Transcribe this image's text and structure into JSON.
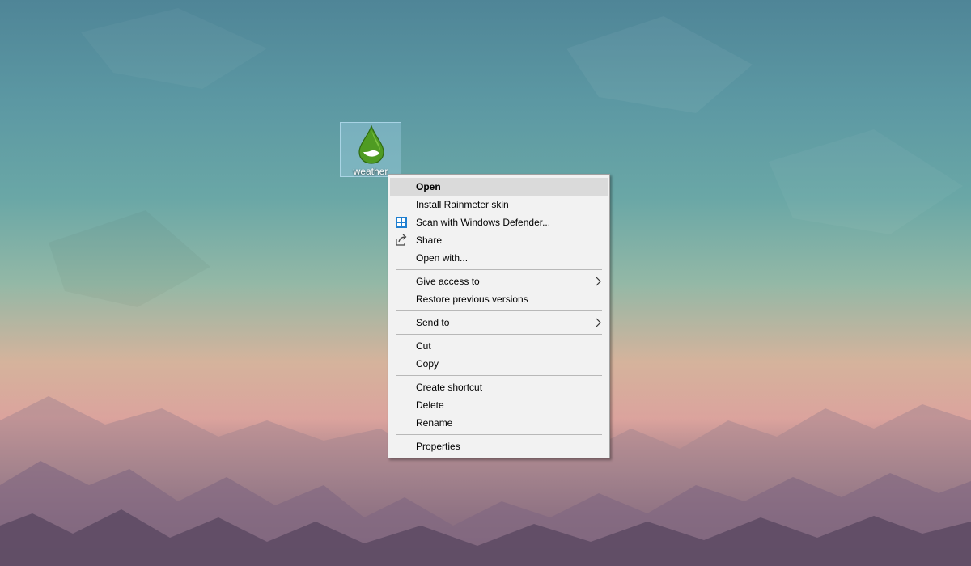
{
  "desktop": {
    "icon": {
      "name": "weather",
      "icon": "rainmeter-drop-icon"
    }
  },
  "context_menu": {
    "items": [
      {
        "label": "Open",
        "bold": true,
        "highlighted": true
      },
      {
        "label": "Install Rainmeter skin"
      },
      {
        "label": "Scan with Windows Defender...",
        "icon": "windows-defender-icon"
      },
      {
        "label": "Share",
        "icon": "share-icon"
      },
      {
        "label": "Open with..."
      },
      {
        "label": "Give access to",
        "submenu": true
      },
      {
        "label": "Restore previous versions"
      },
      {
        "label": "Send to",
        "submenu": true
      },
      {
        "label": "Cut"
      },
      {
        "label": "Copy"
      },
      {
        "label": "Create shortcut"
      },
      {
        "label": "Delete"
      },
      {
        "label": "Rename"
      },
      {
        "label": "Properties"
      }
    ]
  },
  "colors": {
    "menu_bg": "#f2f2f2",
    "menu_hover": "#dadada",
    "icon_green": "#5aa62a",
    "defender_blue": "#1f7fd0"
  }
}
